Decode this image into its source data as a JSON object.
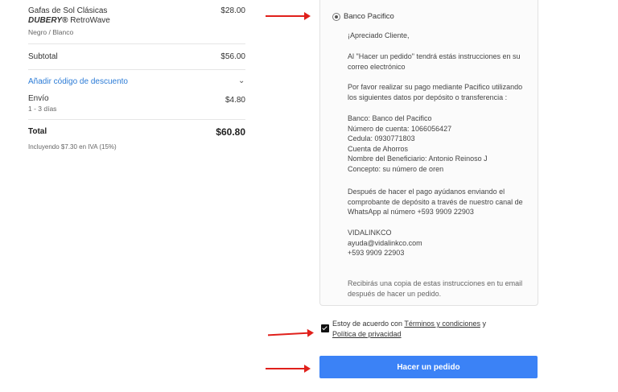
{
  "summary": {
    "product": {
      "name": "Gafas de Sol Clásicas",
      "brand": "DUBERY®",
      "model": " RetroWave",
      "variant": "Negro / Blanco",
      "price": "$28.00"
    },
    "subtotal_label": "Subtotal",
    "subtotal_value": "$56.00",
    "discount_label": "Añadir código de descuento",
    "shipping_label": "Envío",
    "shipping_days": "1 - 3 días",
    "shipping_value": "$4.80",
    "total_label": "Total",
    "total_value": "$60.80",
    "tax_note": "Incluyendo $7.30 en IVA (15%)"
  },
  "payment": {
    "method_label": "Banco Pacifico",
    "greeting": "¡Apreciado Cliente,",
    "intro": "Al \"Hacer un pedido\" tendrá estás instrucciones en su correo electrónico",
    "request": "Por favor realizar su pago mediante Pacifico utilizando los siguientes datos por depósito o transferencia :",
    "bank_lines": [
      "Banco: Banco del Pacifico",
      "Número de cuenta: 1066056427",
      "Cedula: 0930771803",
      "Cuenta de Ahorros",
      "Nombre del Beneficiario: Antonio Reinoso J",
      "Concepto: su número de oren"
    ],
    "after_payment": "Después de hacer el pago ayúdanos enviando el comprobante de depósito a través de nuestro canal de WhatsApp al número +593 9909 22903",
    "company_lines": [
      "VIDALINKCO",
      "ayuda@vidalinkco.com",
      "+593 9909 22903"
    ],
    "copy_note": "Recibirás una copia de estas instrucciones en tu email después de hacer un pedido."
  },
  "agreement": {
    "prefix": "Estoy de acuerdo con ",
    "terms_link": "Términos y condiciones",
    "middle": " y ",
    "privacy_link": "Política de privacidad"
  },
  "order_button_label": "Hacer un pedido",
  "colors": {
    "accent": "#3b82f6",
    "link": "#2b7bd6",
    "annotation": "#e0201b"
  }
}
